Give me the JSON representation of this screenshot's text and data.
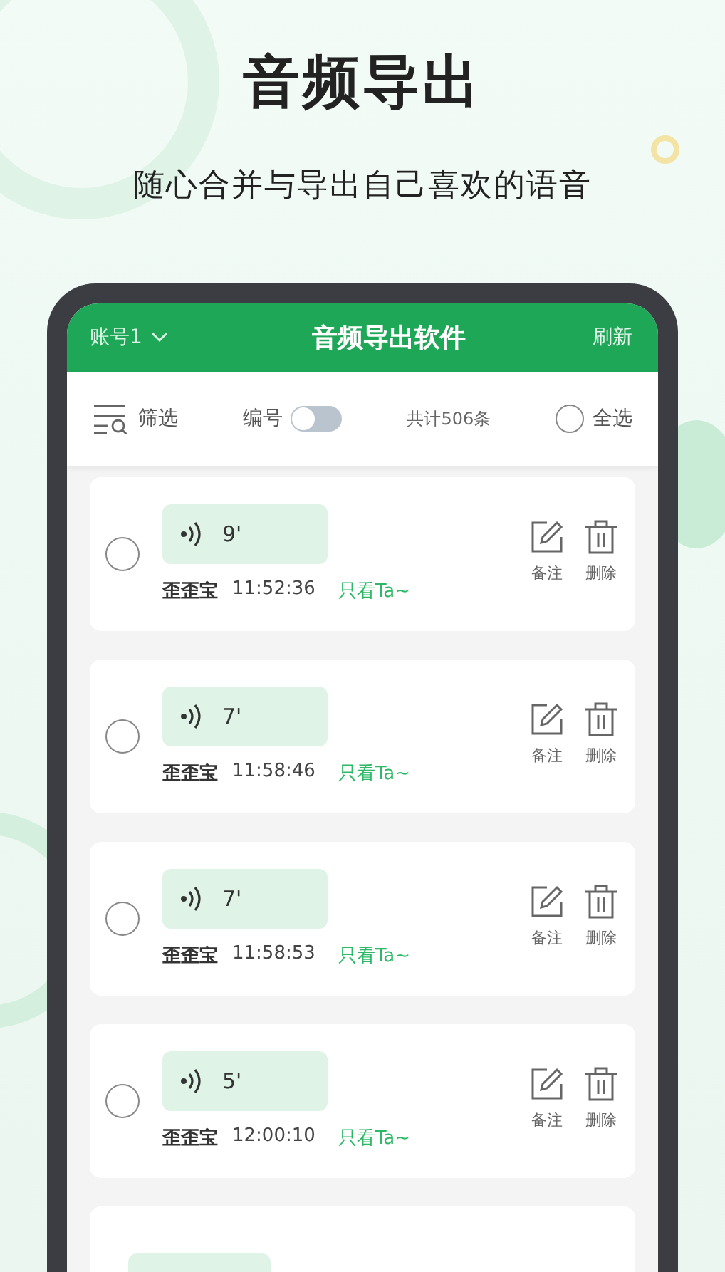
{
  "headline": "音频导出",
  "subtitle": "随心合并与导出自己喜欢的语音",
  "app_bar": {
    "account": "账号1",
    "title": "音频导出软件",
    "refresh": "刷新"
  },
  "toolbar": {
    "filter": "筛选",
    "numbering": "编号",
    "numbering_on": false,
    "total": "共计506条",
    "select_all": "全选",
    "all_selected": false
  },
  "messages": [
    {
      "duration": "9'",
      "sender": "歪歪宝",
      "time": "11:52:36",
      "link": "只看Ta~",
      "note": "备注",
      "delete": "删除",
      "selected": false
    },
    {
      "duration": "7'",
      "sender": "歪歪宝",
      "time": "11:58:46",
      "link": "只看Ta~",
      "note": "备注",
      "delete": "删除",
      "selected": false
    },
    {
      "duration": "7'",
      "sender": "歪歪宝",
      "time": "11:58:53",
      "link": "只看Ta~",
      "note": "备注",
      "delete": "删除",
      "selected": false
    },
    {
      "duration": "5'",
      "sender": "歪歪宝",
      "time": "12:00:10",
      "link": "只看Ta~",
      "note": "备注",
      "delete": "删除",
      "selected": false
    }
  ]
}
